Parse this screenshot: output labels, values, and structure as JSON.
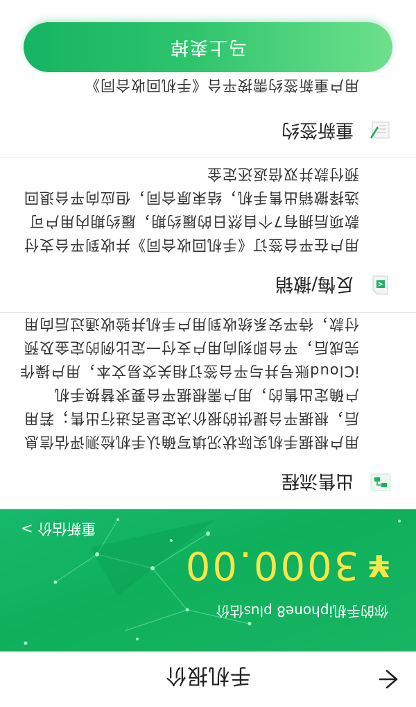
{
  "header": {
    "title": "手机报价"
  },
  "banner": {
    "model_line": "你的手机iphone8 plus估价",
    "currency": "¥",
    "price": "3000.00",
    "re_estimate": "重新估价 >"
  },
  "sections": [
    {
      "title": "出售流程",
      "icon": "flow-icon",
      "body": "用户根据手机实际状况填写确认手机检测评估信息后，根据平台提供的报价决定是否进行出售；若用户确定出售的，用户需根据平台要求替换手机iCloud账号并与平台签订相关交易文本，用户操作完成后，平台即刻向用户支付一定比例的定金及预付款，待平安系统收到用户手机并验收通过后向用户支付尾款部分"
    },
    {
      "title": "反悔/撤销",
      "icon": "undo-icon",
      "body": "用户在平台签订《手机回收合同》并收到平台支付款项后拥有7个自然日的履约期，履约期内用户可选择撤销出售手机，结束原合同，但应向平台退回预付款并双倍返还定金"
    },
    {
      "title": "重新签约",
      "icon": "sign-icon",
      "body": "用户重新签约需按平台《手机回收合同》"
    }
  ],
  "footer": {
    "sell_label": "马上卖掉"
  },
  "colors": {
    "brand_green": "#12b25f",
    "price_yellow": "#f7e64a"
  }
}
